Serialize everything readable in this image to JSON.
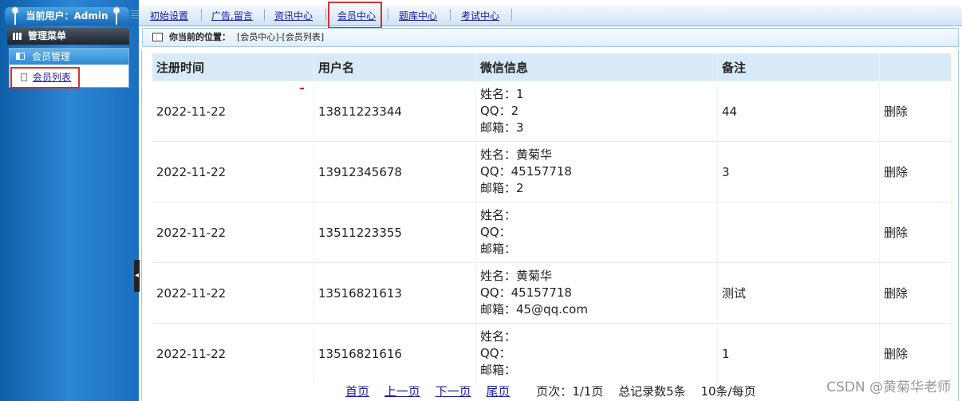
{
  "sidebar": {
    "user_label": "当前用户：Admin",
    "menu_title": "管理菜单",
    "group_title": "会员管理",
    "items": [
      {
        "label": "会员列表"
      }
    ]
  },
  "topnav": {
    "items": [
      {
        "label": "初始设置"
      },
      {
        "label": "广告,留言"
      },
      {
        "label": "资讯中心"
      },
      {
        "label": "会员中心"
      },
      {
        "label": "题库中心"
      },
      {
        "label": "考试中心"
      }
    ]
  },
  "breadcrumb": {
    "label": "你当前的位置：",
    "value": "[会员中心]-[会员列表]"
  },
  "table": {
    "headers": [
      "注册时间",
      "用户名",
      "微信信息",
      "备注",
      ""
    ],
    "rows": [
      {
        "date": "2022-11-22",
        "username": "13811223344",
        "name": "姓名：1",
        "qq": "QQ：2",
        "email": "邮箱：3",
        "note": "44",
        "action": "删除"
      },
      {
        "date": "2022-11-22",
        "username": "13912345678",
        "name": "姓名：黄菊华",
        "qq": "QQ：45157718",
        "email": "邮箱：2",
        "note": "3",
        "action": "删除"
      },
      {
        "date": "2022-11-22",
        "username": "13511223355",
        "name": "姓名：",
        "qq": "QQ：",
        "email": "邮箱：",
        "note": "",
        "action": "删除"
      },
      {
        "date": "2022-11-22",
        "username": "13516821613",
        "name": "姓名：黄菊华",
        "qq": "QQ：45157718",
        "email": "邮箱：45@qq.com",
        "note": "测试",
        "action": "删除"
      },
      {
        "date": "2022-11-22",
        "username": "13516821616",
        "name": "姓名：",
        "qq": "QQ：",
        "email": "邮箱：",
        "note": "1",
        "action": "删除"
      }
    ]
  },
  "pager": {
    "first": "首页",
    "prev": "上一页",
    "next": "下一页",
    "last": "尾页",
    "page_info": "页次：1/1页",
    "total": "总记录数5条",
    "per_page": "10条/每页"
  },
  "watermark": "CSDN @黄菊华老师",
  "colors": {
    "sidebar": "#1a6fbf",
    "highlight_border": "#d43030",
    "link": "#1a1aa6"
  }
}
